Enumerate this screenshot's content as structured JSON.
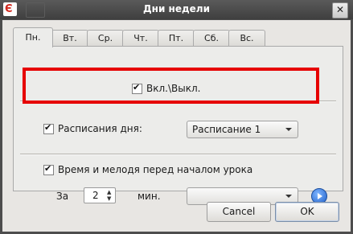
{
  "window": {
    "title": "Дни недели",
    "close_glyph": "✕",
    "app_icon_glyph": "Є"
  },
  "tabs": [
    {
      "label": "Пн.",
      "active": true
    },
    {
      "label": "Вт.",
      "active": false
    },
    {
      "label": "Ср.",
      "active": false
    },
    {
      "label": "Чт.",
      "active": false
    },
    {
      "label": "Пт.",
      "active": false
    },
    {
      "label": "Сб.",
      "active": false
    },
    {
      "label": "Вс.",
      "active": false
    }
  ],
  "onoff": {
    "label": "Вкл.\\Выкл.",
    "checked": true
  },
  "schedule": {
    "label": "Расписания дня:",
    "checked": true,
    "selected": "Расписание 1"
  },
  "melody": {
    "label": "Время и мелодя перед началом урока",
    "checked": true,
    "prefix": "За",
    "minutes": "2",
    "suffix": "мин.",
    "selected": ""
  },
  "buttons": {
    "cancel": "Cancel",
    "ok": "OK"
  },
  "colors": {
    "highlight": "#e60000",
    "titlebar": "#4a4a4a"
  }
}
